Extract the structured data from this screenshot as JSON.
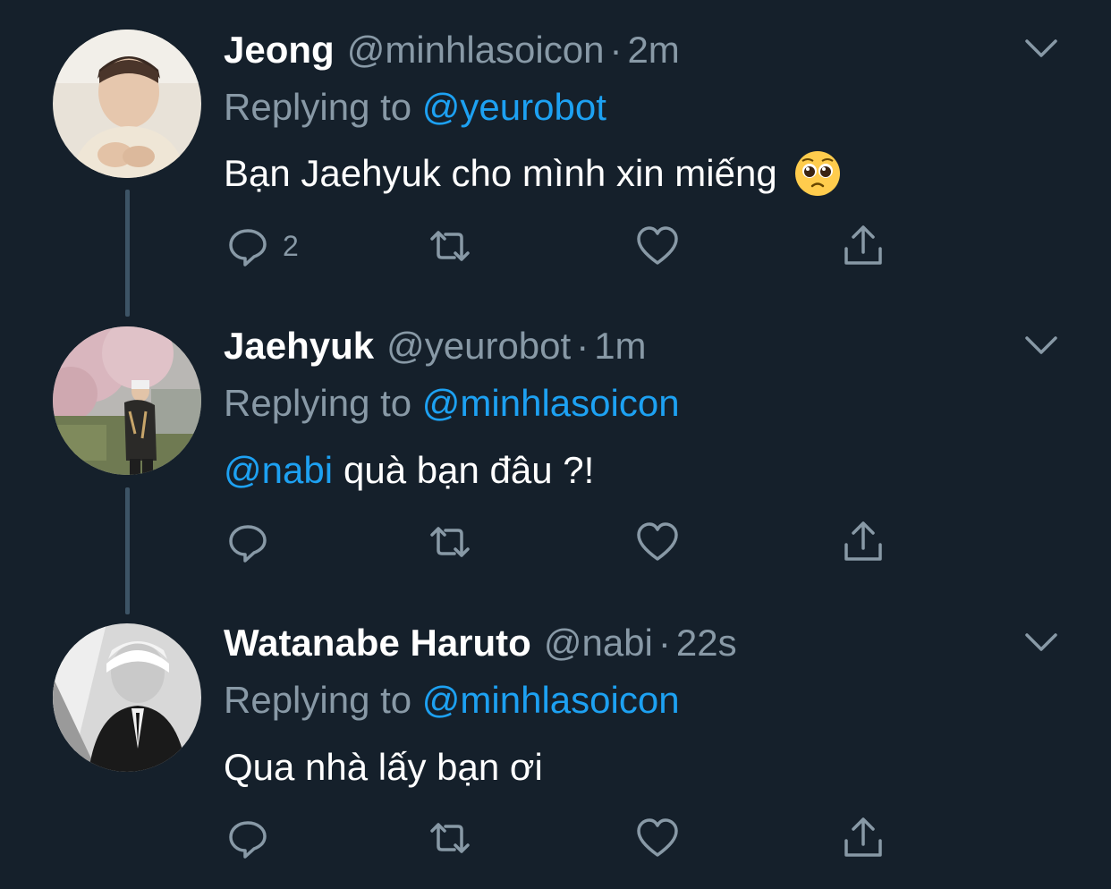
{
  "tweets": [
    {
      "display_name": "Jeong",
      "handle": "@minhlasoicon",
      "separator": "·",
      "time": "2m",
      "replying_prefix": "Replying to",
      "replying_handle": "@yeurobot",
      "text": "Bạn Jaehyuk cho mình xin miếng",
      "emoji": "pleading-face-icon",
      "reply_count": "2"
    },
    {
      "display_name": "Jaehyuk",
      "handle": "@yeurobot",
      "separator": "·",
      "time": "1m",
      "replying_prefix": "Replying to",
      "replying_handle": "@minhlasoicon",
      "text_mention": "@nabi",
      "text": "quà bạn đâu ?!",
      "reply_count": ""
    },
    {
      "display_name": "Watanabe Haruto",
      "handle": "@nabi",
      "separator": "·",
      "time": "22s",
      "replying_prefix": "Replying to",
      "replying_handle": "@minhlasoicon",
      "text": "Qua nhà lấy bạn ơi",
      "reply_count": ""
    }
  ],
  "colors": {
    "background": "#15202b",
    "primary_text": "#ffffff",
    "secondary_text": "#8899a6",
    "accent": "#1da1f2",
    "thread_line": "#3d5466"
  }
}
